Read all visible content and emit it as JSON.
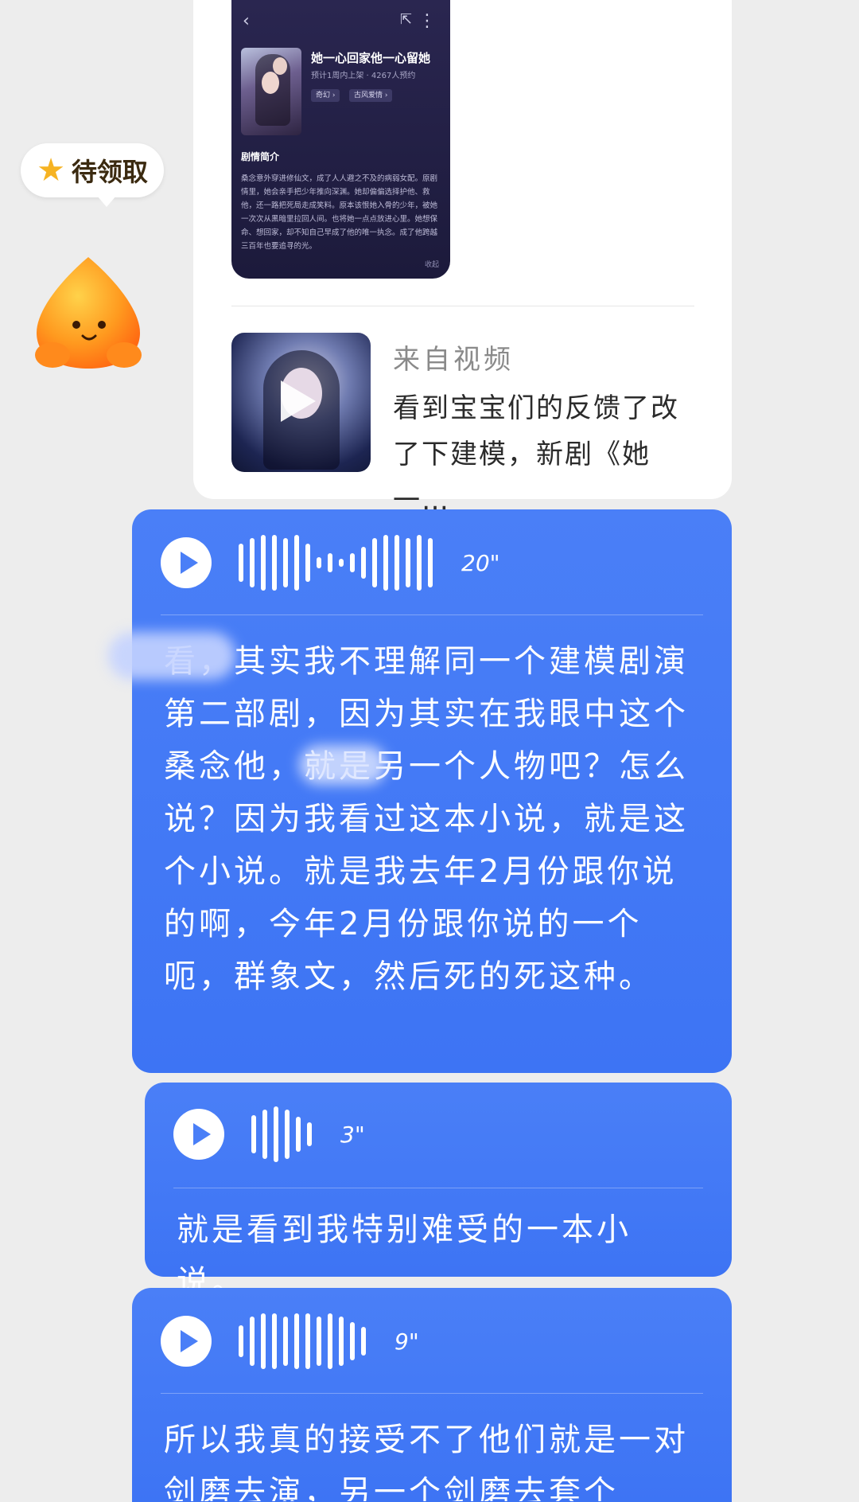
{
  "reward": {
    "label": "待领取"
  },
  "share_card": {
    "book": {
      "title": "她一心回家他一心留她",
      "meta": "预计1周内上架 · 4267人预约",
      "tags": [
        "奇幻 ›",
        "古风爱情 ›"
      ],
      "synopsis_heading": "剧情简介",
      "synopsis": "桑念意外穿进修仙文，成了人人避之不及的病弱女配。原剧情里，她会亲手把少年推向深渊。她却偏偏选择护他、救他，还一路把死局走成笑料。原本该恨她入骨的少年，被她一次次从黑暗里拉回人间。也将她一点点放进心里。她想保命、想回家，却不知自己早成了他的唯一执念。成了他跨越三百年也要追寻的光。",
      "collapse": "收起"
    },
    "video": {
      "source": "来自视频",
      "description": "看到宝宝们的反馈了改了下建模，新剧《她一…"
    }
  },
  "voice_messages": [
    {
      "duration": "20\"",
      "text": "看，其实我不理解同一个建模剧演第二部剧，因为其实在我眼中这个桑念他，就是另一个人物吧？怎么说？因为我看过这本小说，就是这个小说。就是我去年2月份跟你说的啊，今年2月份跟你说的一个呃，群象文，然后死的死这种。"
    },
    {
      "duration": "3\"",
      "text": "就是看到我特别难受的一本小说。"
    },
    {
      "duration": "9\"",
      "text": "所以我真的接受不了他们就是一对剑磨去演，另一个剑磨去套个"
    }
  ],
  "icons": [
    "star-icon",
    "mascot-icon",
    "back-icon",
    "share-icon",
    "more-icon",
    "play-icon"
  ],
  "colors": {
    "bubble": "#4a7ff7",
    "background": "#ededed",
    "reward_star": "#f6b323"
  }
}
